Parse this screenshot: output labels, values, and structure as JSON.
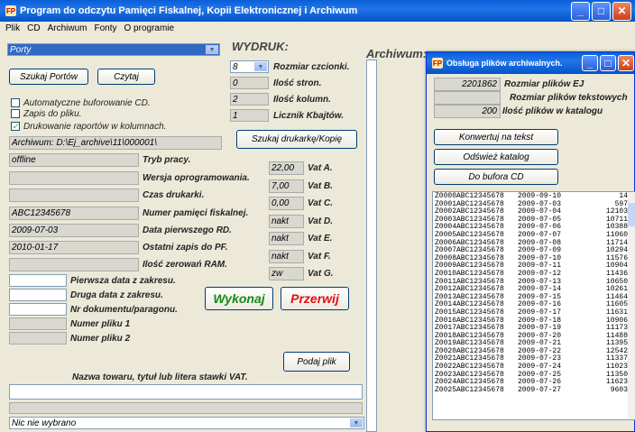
{
  "main": {
    "title": "Program do odczytu Pamięci Fiskalnej, Kopii Elektronicznej i Archiwum",
    "menu": [
      "Plik",
      "CD",
      "Archiwum",
      "Fonty",
      "O programie"
    ],
    "port_combo": "Porty",
    "btn_szukaj": "Szukaj Portów",
    "btn_czytaj": "Czytaj",
    "chk1": "Automatyczne buforowanie CD.",
    "chk2": "Zapis do pliku.",
    "chk3": "Drukowanie raportów w kolumnach.",
    "archiwum_path": "Archiwum: D:\\Ej_archive\\11\\000001\\",
    "wydruk": "WYDRUK:",
    "font_size_val": "8",
    "font_size_lbl": "Rozmiar czcionki.",
    "pages_val": "0",
    "pages_lbl": "Ilość stron.",
    "cols_val": "2",
    "cols_lbl": "Ilość kolumn.",
    "kb_val": "1",
    "kb_lbl": "Licznik Kbajtów.",
    "btn_printer": "Szukaj drukarkę/Kopię",
    "info": [
      {
        "val": "offline",
        "lbl": "Tryb pracy."
      },
      {
        "val": "",
        "lbl": "Wersja oprogramowania."
      },
      {
        "val": "",
        "lbl": "Czas drukarki."
      },
      {
        "val": "ABC12345678",
        "lbl": "Numer pamięci fiskalnej."
      },
      {
        "val": "2009-07-03",
        "lbl": "Data pierwszego RD."
      },
      {
        "val": "2010-01-17",
        "lbl": "Ostatni zapis do PF."
      },
      {
        "val": "",
        "lbl": "Ilość zerowań RAM."
      }
    ],
    "vat": [
      {
        "val": "22,00",
        "lbl": "Vat A."
      },
      {
        "val": "7,00",
        "lbl": "Vat B."
      },
      {
        "val": "0,00",
        "lbl": "Vat C."
      },
      {
        "val": "nakt",
        "lbl": "Vat D."
      },
      {
        "val": "nakt",
        "lbl": "Vat E."
      },
      {
        "val": "nakt",
        "lbl": "Vat F."
      },
      {
        "val": "zw",
        "lbl": "Vat G."
      }
    ],
    "ranges": [
      "Pierwsza data z zakresu.",
      "Druga data z zakresu.",
      "Nr dokumentu/paragonu.",
      "Numer pliku 1",
      "Numer pliku 2"
    ],
    "btn_wykonaj": "Wykonaj",
    "btn_przerwij": "Przerwij",
    "btn_podaj": "Podaj plik",
    "vat_label": "Nazwa towaru, tytuł lub litera stawki VAT.",
    "bottom_combo": "Nic nie wybrano",
    "archiwum_label": "Archiwum:",
    "colors": {
      "wykonaj": "#138a13",
      "przerwij": "#e01010"
    }
  },
  "sub": {
    "title": "Obsługa plików archiwalnych.",
    "ej_val": "2201862",
    "ej_lbl": "Rozmiar plików EJ",
    "txt_val": "",
    "txt_lbl": "Rozmiar plików tekstowych",
    "cnt_val": "200",
    "cnt_lbl": "Ilość plików w katalogu",
    "btn_conv": "Konwertuj na tekst",
    "btn_ref": "Odśwież katalog",
    "btn_buf": "Do bufora CD",
    "files": [
      [
        "Z0000ABC12345678",
        "2009-09-10",
        "14"
      ],
      [
        "Z0001ABC12345678",
        "2009-07-03",
        "597"
      ],
      [
        "Z0002ABC12345678",
        "2009-07-04",
        "12103"
      ],
      [
        "Z0003ABC12345678",
        "2009-07-05",
        "10711"
      ],
      [
        "Z0004ABC12345678",
        "2009-07-06",
        "10388"
      ],
      [
        "Z0005ABC12345678",
        "2009-07-07",
        "11060"
      ],
      [
        "Z0006ABC12345678",
        "2009-07-08",
        "11714"
      ],
      [
        "Z0007ABC12345678",
        "2009-07-09",
        "10294"
      ],
      [
        "Z0008ABC12345678",
        "2009-07-10",
        "11576"
      ],
      [
        "Z0009ABC12345678",
        "2009-07-11",
        "10904"
      ],
      [
        "Z0010ABC12345678",
        "2009-07-12",
        "11436"
      ],
      [
        "Z0011ABC12345678",
        "2009-07-13",
        "10650"
      ],
      [
        "Z0012ABC12345678",
        "2009-07-14",
        "10261"
      ],
      [
        "Z0013ABC12345678",
        "2009-07-15",
        "11464"
      ],
      [
        "Z0014ABC12345678",
        "2009-07-16",
        "11605"
      ],
      [
        "Z0015ABC12345678",
        "2009-07-17",
        "11631"
      ],
      [
        "Z0016ABC12345678",
        "2009-07-18",
        "10906"
      ],
      [
        "Z0017ABC12345678",
        "2009-07-19",
        "11173"
      ],
      [
        "Z0018ABC12345678",
        "2009-07-20",
        "11488"
      ],
      [
        "Z0019ABC12345678",
        "2009-07-21",
        "11395"
      ],
      [
        "Z0020ABC12345678",
        "2009-07-22",
        "12542"
      ],
      [
        "Z0021ABC12345678",
        "2009-07-23",
        "11337"
      ],
      [
        "Z0022ABC12345678",
        "2009-07-24",
        "11023"
      ],
      [
        "Z0023ABC12345678",
        "2009-07-25",
        "11350"
      ],
      [
        "Z0024ABC12345678",
        "2009-07-26",
        "11623"
      ],
      [
        "Z0025ABC12345678",
        "2009-07-27",
        "9603"
      ]
    ]
  }
}
